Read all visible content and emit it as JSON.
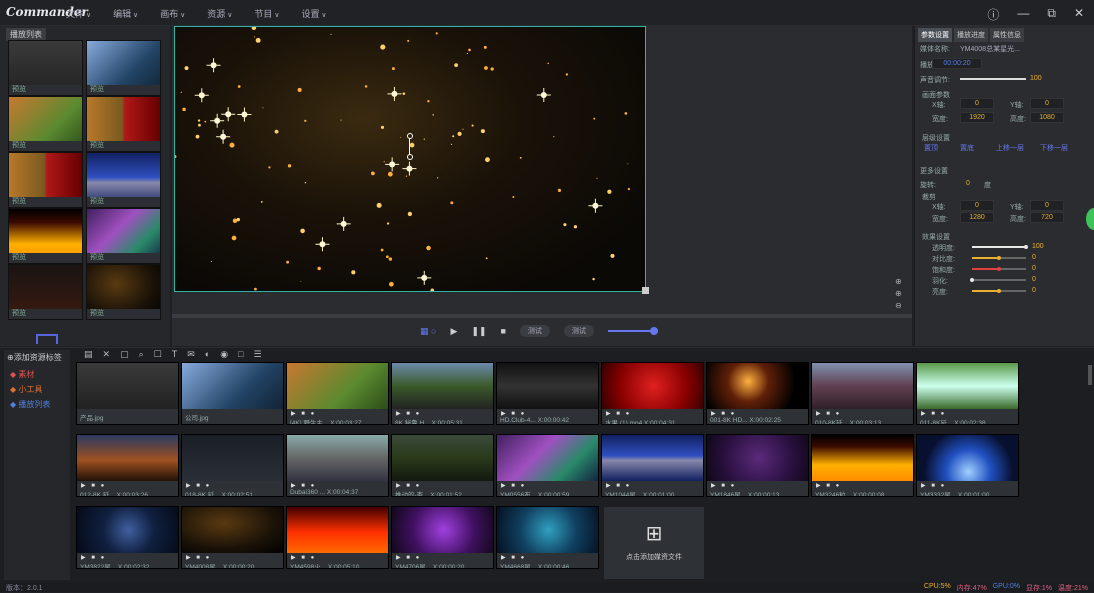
{
  "app": {
    "logo": "Commander",
    "version": "版本：2.0.1"
  },
  "menu": [
    "文件",
    "编辑",
    "画布",
    "资源",
    "节目",
    "设置"
  ],
  "window": {
    "help": "ⓘ",
    "min": "—",
    "restore": "⧉",
    "close": "✕"
  },
  "left": {
    "title": "播放列表",
    "thumbs": [
      {
        "label": "预览",
        "img": "doc"
      },
      {
        "label": "预览",
        "img": "led"
      },
      {
        "label": "预览",
        "img": "tiger"
      },
      {
        "label": "预览",
        "img": "tigerrose"
      },
      {
        "label": "预览",
        "img": "tigerrose"
      },
      {
        "label": "预览",
        "img": "stage"
      },
      {
        "label": "预览",
        "img": "fire"
      },
      {
        "label": "预览",
        "img": "nebula"
      },
      {
        "label": "预览",
        "img": "dark"
      },
      {
        "label": "预览",
        "img": "sparks"
      }
    ]
  },
  "player": {
    "btn1": "测试",
    "btn2": "测试"
  },
  "props": {
    "tabs": [
      "参数设置",
      "播放进度",
      "属性信息"
    ],
    "name_label": "媒体名称:",
    "name_value": "YM4008总某星光...",
    "dur_label": "播放时长:",
    "dur_value": "00:00:20",
    "vol_label": "声音调节:",
    "vol_value": "100",
    "screen_label": "画面参数",
    "x_label": "X轴:",
    "x_value": "0",
    "y_label": "Y轴:",
    "y_value": "0",
    "w_label": "宽度:",
    "w_value": "1920",
    "h_label": "高度:",
    "h_value": "1080",
    "layer_label": "层级设置",
    "layers": [
      "置顶",
      "置底",
      "上移一层",
      "下移一层"
    ],
    "more_label": "更多设置",
    "rot_label": "旋转:",
    "rot_value": "0",
    "rot_unit": "度",
    "crop_label": "裁剪",
    "cx_label": "X轴:",
    "cx_value": "0",
    "cy_label": "Y轴:",
    "cy_value": "0",
    "cw_label": "宽度:",
    "cw_value": "1280",
    "ch_label": "高度:",
    "ch_value": "720",
    "fx_label": "效果设置",
    "fx": [
      {
        "label": "透明度:",
        "value": "100",
        "pct": 1.0,
        "color": "#e8e8e8"
      },
      {
        "label": "对比度:",
        "value": "0",
        "pct": 0.5,
        "color": "#e8b030"
      },
      {
        "label": "饱和度:",
        "value": "0",
        "pct": 0.5,
        "color": "#e04040"
      },
      {
        "label": "羽化:",
        "value": "0",
        "pct": 0.0,
        "color": "#e8e8e8"
      },
      {
        "label": "亮度:",
        "value": "0",
        "pct": 0.5,
        "color": "#e8b030"
      }
    ]
  },
  "bottom": {
    "addtag": "添加资源标签",
    "side": [
      {
        "label": "素材",
        "color": "#e05050"
      },
      {
        "label": "小工具",
        "color": "#e07030"
      },
      {
        "label": "播放列表",
        "color": "#5080e0"
      }
    ],
    "tools": [
      "▤",
      "✕",
      "▢",
      "⌕",
      "☐",
      "T",
      "✉",
      "◐",
      "◉",
      "□",
      "☰"
    ],
    "cells": [
      {
        "label": "产品.jpg",
        "img": "doc",
        "ctl": false
      },
      {
        "label": "公司.jpg",
        "img": "led",
        "ctl": false
      },
      {
        "label": "[4K] 野生主...  X:00:03:27",
        "img": "tiger",
        "ctl": true
      },
      {
        "label": "8K 秘鲁 H...  X:00:05:31",
        "img": "road",
        "ctl": true
      },
      {
        "label": "HD.Club-4...  X:00:00:42",
        "img": "k4",
        "ctl": true
      },
      {
        "label": "水果 (1).mp4  X:00:04:31",
        "img": "rose",
        "ctl": true
      },
      {
        "label": "001-8K HD...  X:00:02:25",
        "img": "fireperf",
        "ctl": true
      },
      {
        "label": "010-8K延...  X:00:03:13",
        "img": "city",
        "ctl": true
      },
      {
        "label": "011-8K延...  X:00:02:38",
        "img": "falls",
        "ctl": true
      },
      {
        "label": "012-8K 延...  X:00:03:26",
        "img": "nightcity",
        "ctl": true
      },
      {
        "label": "018-8K 延...  X:00:02:51",
        "img": "cloudsdark",
        "ctl": true
      },
      {
        "label": "Dubai360 ...  X:00:04:37",
        "img": "dubai",
        "ctl": true
      },
      {
        "label": "推动的-杏...  X:00:01:52",
        "img": "field",
        "ctl": true
      },
      {
        "label": "YM0556布...  X:00:00:59",
        "img": "nebula",
        "ctl": true
      },
      {
        "label": "YM1044星...  X:00:01:00",
        "img": "stage",
        "ctl": true
      },
      {
        "label": "YM1846星...  X:00:00:13",
        "img": "purple",
        "ctl": true
      },
      {
        "label": "YM3246粒...  X:00:00:08",
        "img": "fire",
        "ctl": true
      },
      {
        "label": "YM3332星...  X:00:01:00",
        "img": "planet",
        "ctl": true
      },
      {
        "label": "YM3822星...  X:00:02:32",
        "img": "galaxy",
        "ctl": true
      },
      {
        "label": "YM4008星...  X:00:00:20",
        "img": "sparks",
        "ctl": true
      },
      {
        "label": "YM4598火...  X:00:05:10",
        "img": "fire2",
        "ctl": true
      },
      {
        "label": "YM4706星...  X:00:00:20",
        "img": "purple2",
        "ctl": true
      },
      {
        "label": "YM4668星...  X:00:00:46",
        "img": "bluestars",
        "ctl": true
      }
    ],
    "add_label": "点击添加媒资文件"
  },
  "status": {
    "cpu": "CPU:5%",
    "mem": "内存:47%",
    "gpu": "GPU:0%",
    "disk": "显存:1%",
    "temp": "温度:21%"
  }
}
